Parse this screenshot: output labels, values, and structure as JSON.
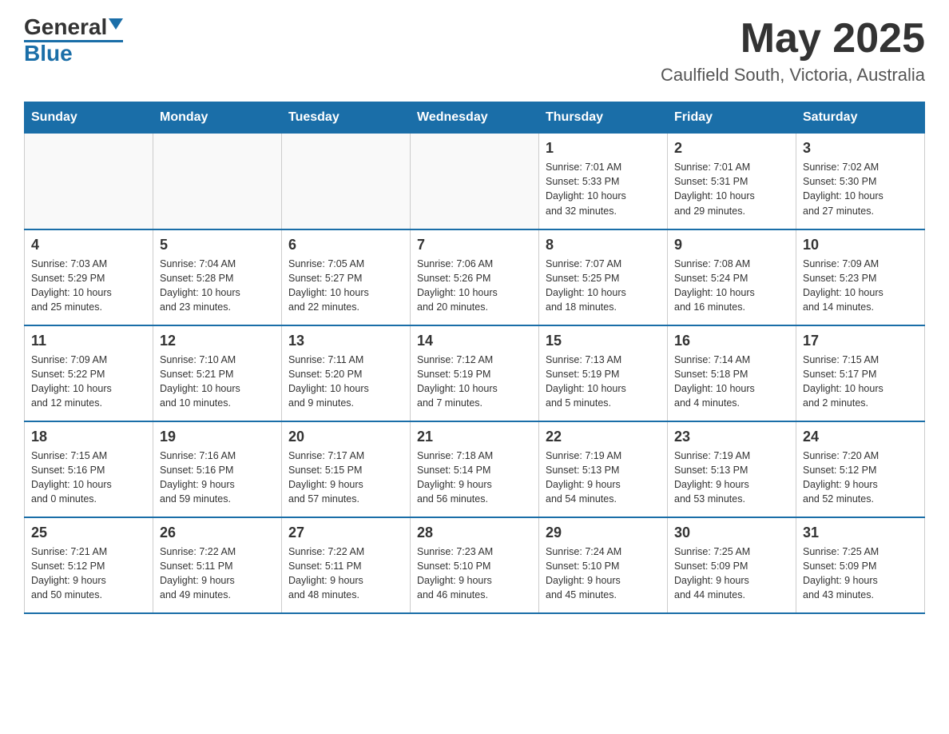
{
  "header": {
    "logo_general": "General",
    "logo_blue": "Blue",
    "main_title": "May 2025",
    "subtitle": "Caulfield South, Victoria, Australia"
  },
  "days_of_week": [
    "Sunday",
    "Monday",
    "Tuesday",
    "Wednesday",
    "Thursday",
    "Friday",
    "Saturday"
  ],
  "weeks": [
    {
      "days": [
        {
          "num": "",
          "info": "",
          "empty": true
        },
        {
          "num": "",
          "info": "",
          "empty": true
        },
        {
          "num": "",
          "info": "",
          "empty": true
        },
        {
          "num": "",
          "info": "",
          "empty": true
        },
        {
          "num": "1",
          "info": "Sunrise: 7:01 AM\nSunset: 5:33 PM\nDaylight: 10 hours\nand 32 minutes.",
          "empty": false
        },
        {
          "num": "2",
          "info": "Sunrise: 7:01 AM\nSunset: 5:31 PM\nDaylight: 10 hours\nand 29 minutes.",
          "empty": false
        },
        {
          "num": "3",
          "info": "Sunrise: 7:02 AM\nSunset: 5:30 PM\nDaylight: 10 hours\nand 27 minutes.",
          "empty": false
        }
      ]
    },
    {
      "days": [
        {
          "num": "4",
          "info": "Sunrise: 7:03 AM\nSunset: 5:29 PM\nDaylight: 10 hours\nand 25 minutes.",
          "empty": false
        },
        {
          "num": "5",
          "info": "Sunrise: 7:04 AM\nSunset: 5:28 PM\nDaylight: 10 hours\nand 23 minutes.",
          "empty": false
        },
        {
          "num": "6",
          "info": "Sunrise: 7:05 AM\nSunset: 5:27 PM\nDaylight: 10 hours\nand 22 minutes.",
          "empty": false
        },
        {
          "num": "7",
          "info": "Sunrise: 7:06 AM\nSunset: 5:26 PM\nDaylight: 10 hours\nand 20 minutes.",
          "empty": false
        },
        {
          "num": "8",
          "info": "Sunrise: 7:07 AM\nSunset: 5:25 PM\nDaylight: 10 hours\nand 18 minutes.",
          "empty": false
        },
        {
          "num": "9",
          "info": "Sunrise: 7:08 AM\nSunset: 5:24 PM\nDaylight: 10 hours\nand 16 minutes.",
          "empty": false
        },
        {
          "num": "10",
          "info": "Sunrise: 7:09 AM\nSunset: 5:23 PM\nDaylight: 10 hours\nand 14 minutes.",
          "empty": false
        }
      ]
    },
    {
      "days": [
        {
          "num": "11",
          "info": "Sunrise: 7:09 AM\nSunset: 5:22 PM\nDaylight: 10 hours\nand 12 minutes.",
          "empty": false
        },
        {
          "num": "12",
          "info": "Sunrise: 7:10 AM\nSunset: 5:21 PM\nDaylight: 10 hours\nand 10 minutes.",
          "empty": false
        },
        {
          "num": "13",
          "info": "Sunrise: 7:11 AM\nSunset: 5:20 PM\nDaylight: 10 hours\nand 9 minutes.",
          "empty": false
        },
        {
          "num": "14",
          "info": "Sunrise: 7:12 AM\nSunset: 5:19 PM\nDaylight: 10 hours\nand 7 minutes.",
          "empty": false
        },
        {
          "num": "15",
          "info": "Sunrise: 7:13 AM\nSunset: 5:19 PM\nDaylight: 10 hours\nand 5 minutes.",
          "empty": false
        },
        {
          "num": "16",
          "info": "Sunrise: 7:14 AM\nSunset: 5:18 PM\nDaylight: 10 hours\nand 4 minutes.",
          "empty": false
        },
        {
          "num": "17",
          "info": "Sunrise: 7:15 AM\nSunset: 5:17 PM\nDaylight: 10 hours\nand 2 minutes.",
          "empty": false
        }
      ]
    },
    {
      "days": [
        {
          "num": "18",
          "info": "Sunrise: 7:15 AM\nSunset: 5:16 PM\nDaylight: 10 hours\nand 0 minutes.",
          "empty": false
        },
        {
          "num": "19",
          "info": "Sunrise: 7:16 AM\nSunset: 5:16 PM\nDaylight: 9 hours\nand 59 minutes.",
          "empty": false
        },
        {
          "num": "20",
          "info": "Sunrise: 7:17 AM\nSunset: 5:15 PM\nDaylight: 9 hours\nand 57 minutes.",
          "empty": false
        },
        {
          "num": "21",
          "info": "Sunrise: 7:18 AM\nSunset: 5:14 PM\nDaylight: 9 hours\nand 56 minutes.",
          "empty": false
        },
        {
          "num": "22",
          "info": "Sunrise: 7:19 AM\nSunset: 5:13 PM\nDaylight: 9 hours\nand 54 minutes.",
          "empty": false
        },
        {
          "num": "23",
          "info": "Sunrise: 7:19 AM\nSunset: 5:13 PM\nDaylight: 9 hours\nand 53 minutes.",
          "empty": false
        },
        {
          "num": "24",
          "info": "Sunrise: 7:20 AM\nSunset: 5:12 PM\nDaylight: 9 hours\nand 52 minutes.",
          "empty": false
        }
      ]
    },
    {
      "days": [
        {
          "num": "25",
          "info": "Sunrise: 7:21 AM\nSunset: 5:12 PM\nDaylight: 9 hours\nand 50 minutes.",
          "empty": false
        },
        {
          "num": "26",
          "info": "Sunrise: 7:22 AM\nSunset: 5:11 PM\nDaylight: 9 hours\nand 49 minutes.",
          "empty": false
        },
        {
          "num": "27",
          "info": "Sunrise: 7:22 AM\nSunset: 5:11 PM\nDaylight: 9 hours\nand 48 minutes.",
          "empty": false
        },
        {
          "num": "28",
          "info": "Sunrise: 7:23 AM\nSunset: 5:10 PM\nDaylight: 9 hours\nand 46 minutes.",
          "empty": false
        },
        {
          "num": "29",
          "info": "Sunrise: 7:24 AM\nSunset: 5:10 PM\nDaylight: 9 hours\nand 45 minutes.",
          "empty": false
        },
        {
          "num": "30",
          "info": "Sunrise: 7:25 AM\nSunset: 5:09 PM\nDaylight: 9 hours\nand 44 minutes.",
          "empty": false
        },
        {
          "num": "31",
          "info": "Sunrise: 7:25 AM\nSunset: 5:09 PM\nDaylight: 9 hours\nand 43 minutes.",
          "empty": false
        }
      ]
    }
  ]
}
